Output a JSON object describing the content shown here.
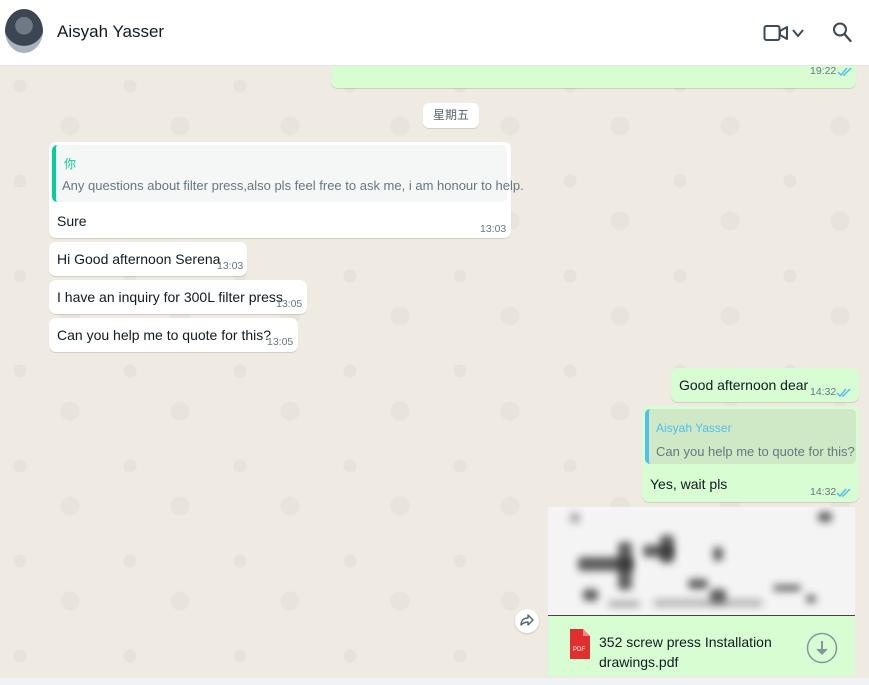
{
  "header": {
    "contact_name": "Aisyah Yasser"
  },
  "date_chip": "星期五",
  "messages": {
    "top_out": {
      "time": "19:22"
    },
    "reply_sure": {
      "quote_author": "你",
      "quote_text": "Any questions about filter press,also pls feel free to ask me, i am honour to help.",
      "text": "Sure",
      "time": "13:03"
    },
    "m1": {
      "text": "Hi Good afternoon Serena",
      "time": "13:03"
    },
    "m2": {
      "text": "I have an inquiry for 300L filter press",
      "time": "13:05"
    },
    "m3": {
      "text": "Can you help me to quote for this?",
      "time": "13:05"
    },
    "out1": {
      "text": "Good afternoon dear",
      "time": "14:32"
    },
    "out2": {
      "quote_author": "Aisyah Yasser",
      "quote_text": "Can you help me to quote for this?",
      "text": "Yes, wait pls",
      "time": "14:32"
    },
    "doc": {
      "name": "352 screw press Installation drawings.pdf",
      "pdf_label": "PDF"
    }
  },
  "colors": {
    "outgoing_bubble": "#d9fdd3",
    "incoming_bubble": "#ffffff",
    "read_ticks": "#53bdeb",
    "quote_accent_in": "#06cf9c"
  }
}
